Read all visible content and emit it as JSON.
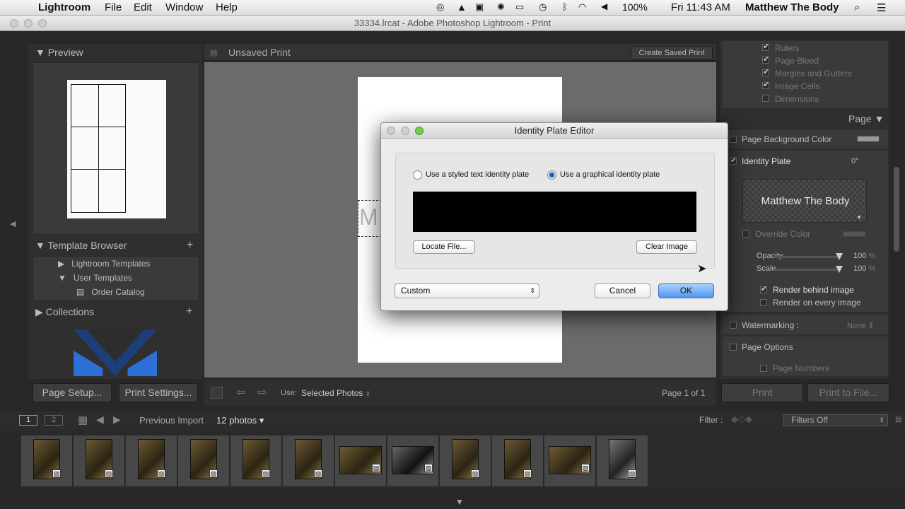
{
  "menubar": {
    "app_name": "Lightroom",
    "items": [
      "File",
      "Edit",
      "Window",
      "Help"
    ],
    "battery": "100%",
    "clock": "Fri 11:43 AM",
    "user": "Matthew The Body"
  },
  "window": {
    "title": "33334.lrcat - Adobe Photoshop Lightroom - Print"
  },
  "left": {
    "preview_title": "Preview",
    "template_browser_title": "Template Browser",
    "templates": [
      "Lightroom Templates",
      "User Templates",
      "Order Catalog"
    ],
    "collections_title": "Collections",
    "page_setup_label": "Page Setup...",
    "print_settings_label": "Print Settings..."
  },
  "center": {
    "header_title": "Unsaved Print",
    "create_saved_print": "Create Saved Print",
    "use_label": "Use:",
    "use_value": "Selected Photos",
    "page_count": "Page 1 of 1",
    "plate_fragment": "M"
  },
  "right": {
    "guides": [
      "Rulers",
      "Page Bleed",
      "Margins and Gutters",
      "Image Cells",
      "Dimensions"
    ],
    "page_title": "Page",
    "page_background_color": "Page Background Color",
    "identity_plate": "Identity Plate",
    "angle": "0°",
    "plate_text": "Matthew The Body",
    "override_color": "Override Color",
    "opacity_label": "Opacity",
    "opacity_value": "100",
    "scale_label": "Scale",
    "scale_value": "100",
    "percent": "%",
    "render_behind": "Render behind image",
    "render_every": "Render on every image",
    "watermarking": "Watermarking :",
    "watermark_value": "None",
    "page_options": "Page Options",
    "page_numbers": "Page Numbers",
    "print_button": "Print",
    "print_to_file": "Print to File..."
  },
  "filmstrip": {
    "view1": "1",
    "view2": "2",
    "source": "Previous Import",
    "count": "12 photos",
    "filter_label": "Filter :",
    "filter_value": "Filters Off"
  },
  "dialog": {
    "title": "Identity Plate Editor",
    "radio_text": "Use a styled text identity plate",
    "radio_graphic": "Use a graphical identity plate",
    "locate_file": "Locate File...",
    "clear_image": "Clear Image",
    "preset": "Custom",
    "cancel": "Cancel",
    "ok": "OK"
  },
  "colors": {
    "accent": "#3b82f6",
    "panel": "#383838",
    "dialog": "#ececec"
  }
}
